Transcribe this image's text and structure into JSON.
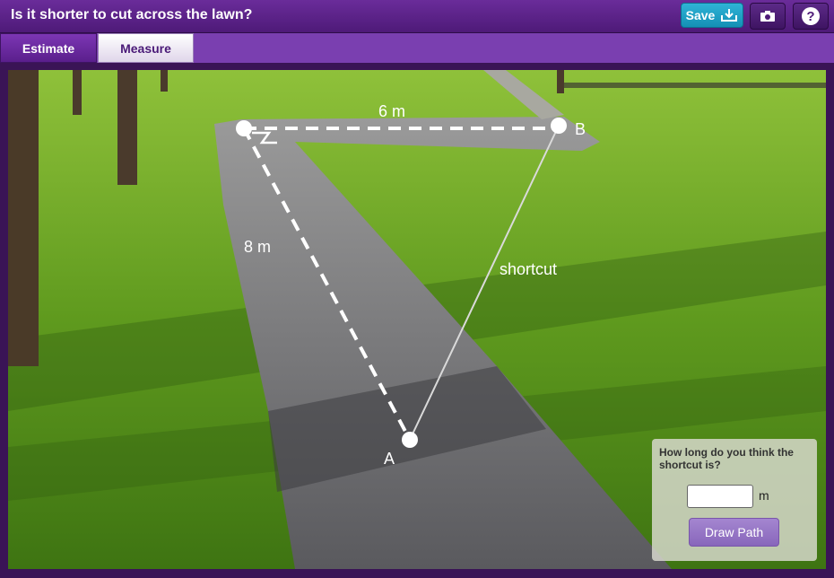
{
  "app": {
    "title": "Is it shorter to cut across the lawn?"
  },
  "toolbar": {
    "save_label": "Save",
    "camera_icon": "camera-icon",
    "help_icon": "help-icon"
  },
  "tabs": [
    {
      "label": "Estimate",
      "active": true
    },
    {
      "label": "Measure",
      "active": false
    }
  ],
  "scene": {
    "point_a_label": "A",
    "point_b_label": "B",
    "segment_top_label": "6 m",
    "segment_left_label": "8 m",
    "shortcut_label": "shortcut"
  },
  "panel": {
    "question": "How long do you think the shortcut is?",
    "answer_value": "",
    "unit": "m",
    "draw_button_label": "Draw Path"
  },
  "colors": {
    "accent": "#6a2c9a",
    "save": "#1fa2c8",
    "panel_button": "#9575c8"
  }
}
